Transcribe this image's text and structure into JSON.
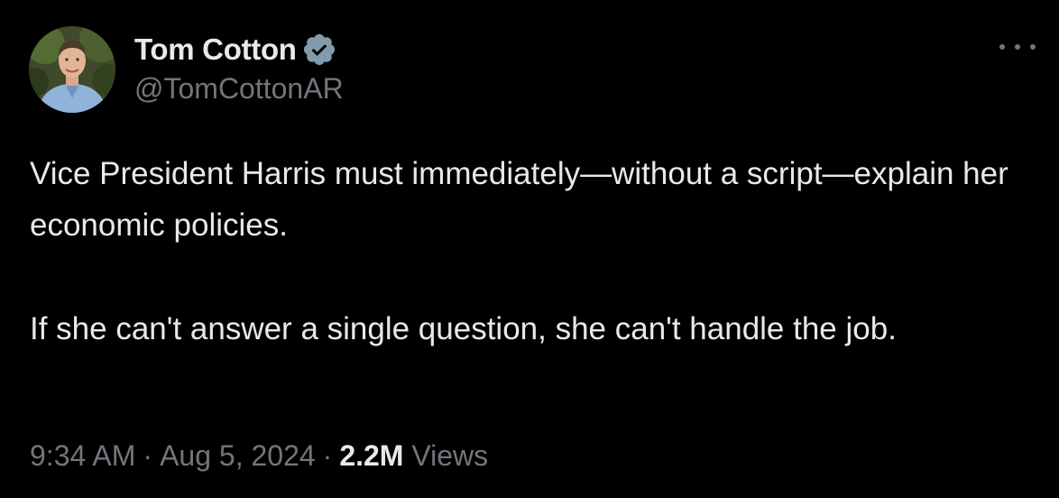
{
  "author": {
    "display_name": "Tom Cotton",
    "handle": "@TomCottonAR",
    "verified": true,
    "avatar_icon": "profile-photo"
  },
  "tweet": {
    "paragraphs": [
      "Vice President Harris must immediately—without a script—explain her economic policies.",
      "If she can't answer a single question, she can't handle the job."
    ],
    "time": "9:34 AM",
    "date": "Aug 5, 2024",
    "separator": "·",
    "views_count": "2.2M",
    "views_label": "Views"
  },
  "icons": {
    "verified": "verified-badge-icon",
    "more": "more-options-icon"
  },
  "colors": {
    "background": "#000000",
    "text_primary": "#e7e9ea",
    "text_secondary": "#71767b",
    "verified_badge": "#829aab"
  }
}
